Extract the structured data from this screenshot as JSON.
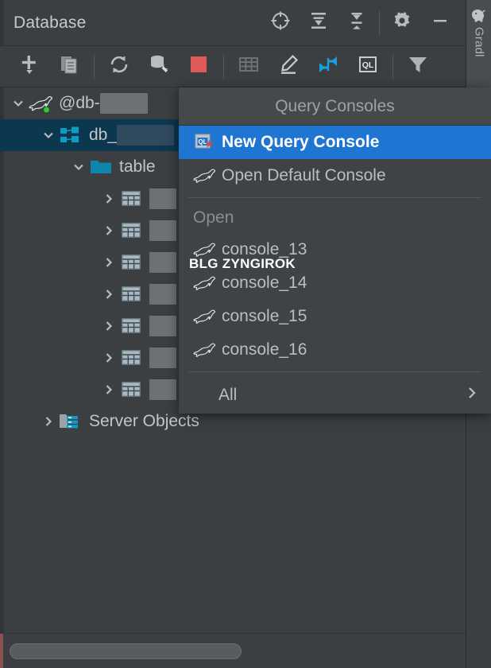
{
  "window": {
    "title": "Database"
  },
  "title_actions": [
    {
      "name": "scroll-from-source-icon",
      "label": "Scroll from Source"
    },
    {
      "name": "expand-all-icon",
      "label": "Expand All"
    },
    {
      "name": "collapse-all-icon",
      "label": "Collapse All"
    },
    {
      "name": "settings-gear-icon",
      "label": "Settings"
    },
    {
      "name": "minimize-icon",
      "label": "Hide"
    }
  ],
  "toolbar": [
    {
      "name": "add-new-icon",
      "label": "New"
    },
    {
      "name": "duplicate-icon",
      "label": "Duplicate"
    },
    {
      "name": "refresh-icon",
      "label": "Refresh"
    },
    {
      "name": "database-tools-icon",
      "label": "Database Tools"
    },
    {
      "name": "stop-icon",
      "label": "Stop"
    },
    {
      "name": "data-editor-icon",
      "label": "Open Data Editor"
    },
    {
      "name": "modify-table-icon",
      "label": "Modify"
    },
    {
      "name": "jump-to-console-icon",
      "label": "Jump to Console"
    },
    {
      "name": "query-console-icon",
      "label": "Query Console"
    },
    {
      "name": "filter-icon",
      "label": "Filter"
    }
  ],
  "tool_tab": {
    "label": "Gradl",
    "icon": "gradle-elephant-icon"
  },
  "tree": {
    "rows": [
      {
        "name": "data-source-node",
        "indent": 0,
        "twisty": "down",
        "icon": "mariadb-seal-icon",
        "connected": true,
        "label": "@db-",
        "redact_width": 60,
        "selected": false
      },
      {
        "name": "database-node",
        "indent": 1,
        "twisty": "down",
        "icon": "schema-icon",
        "label": "db_",
        "redact_width": 72,
        "redact_style": "dark",
        "selected": true
      },
      {
        "name": "tables-folder-node",
        "indent": 2,
        "twisty": "down",
        "icon": "folder-icon",
        "label": "table",
        "redact_width": 0,
        "selected": false
      },
      {
        "name": "table-node",
        "indent": 3,
        "twisty": "right",
        "icon": "table-icon",
        "label": "",
        "redact_width": 34,
        "selected": false
      },
      {
        "name": "table-node",
        "indent": 3,
        "twisty": "right",
        "icon": "table-icon",
        "label": "",
        "redact_width": 34,
        "selected": false
      },
      {
        "name": "table-node",
        "indent": 3,
        "twisty": "right",
        "icon": "table-icon",
        "label": "",
        "redact_width": 34,
        "selected": false
      },
      {
        "name": "table-node",
        "indent": 3,
        "twisty": "right",
        "icon": "table-icon",
        "label": "",
        "redact_width": 34,
        "selected": false
      },
      {
        "name": "table-node",
        "indent": 3,
        "twisty": "right",
        "icon": "table-icon",
        "label": "",
        "redact_width": 34,
        "selected": false
      },
      {
        "name": "table-node",
        "indent": 3,
        "twisty": "right",
        "icon": "table-icon",
        "label": "",
        "redact_width": 34,
        "selected": false
      },
      {
        "name": "table-node",
        "indent": 3,
        "twisty": "right",
        "icon": "table-icon",
        "label": "",
        "redact_width": 34,
        "selected": false
      },
      {
        "name": "server-objects-node",
        "indent": 1,
        "twisty": "right",
        "icon": "server-objects-icon",
        "label": "Server Objects",
        "redact_width": 0,
        "selected": false
      }
    ]
  },
  "menu": {
    "title": "Query Consoles",
    "items": [
      {
        "name": "menu-item-new-query-console",
        "label": "New Query Console",
        "icon": "new-query-console-icon",
        "highlight": true
      },
      {
        "name": "menu-item-open-default-console",
        "label": "Open Default Console",
        "icon": "mariadb-seal-icon",
        "highlight": false
      }
    ],
    "group_label": "Open",
    "open_consoles": [
      {
        "name": "menu-item-console-13",
        "label": "console_13",
        "icon": "mariadb-seal-icon"
      },
      {
        "name": "menu-item-console-14",
        "label": "console_14",
        "icon": "mariadb-seal-icon"
      },
      {
        "name": "menu-item-console-15",
        "label": "console_15",
        "icon": "mariadb-seal-icon"
      },
      {
        "name": "menu-item-console-16",
        "label": "console_16",
        "icon": "mariadb-seal-icon"
      }
    ],
    "all_label": "All",
    "all_arrow": "›"
  },
  "watermark": {
    "text": "BLG ZYNGIROK"
  },
  "colors": {
    "panel_bg": "#3c3f41",
    "menu_bg": "#3f4345",
    "highlight_blue": "#1f76d2",
    "selection_navy": "#0b374f",
    "accent_teal": "#0e85ad",
    "stop_red": "#e05a57",
    "connected_green": "#29d12f",
    "text": "#c5c5c5",
    "muted_text": "#8b8e90",
    "scroll_accent": "#8a5050"
  }
}
